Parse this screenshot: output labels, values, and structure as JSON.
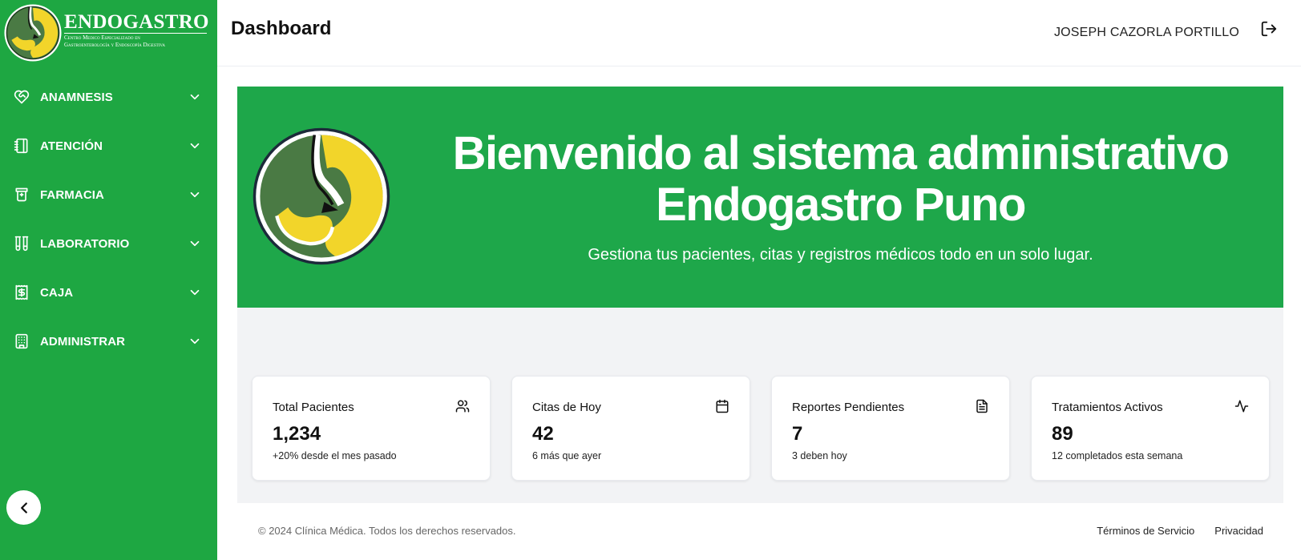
{
  "brand": {
    "name": "ENDOGASTRO",
    "subtitle_line1": "Centro Medico Especializado en",
    "subtitle_line2": "Gastroenterología y Endoscopía Digestiva"
  },
  "sidebar": {
    "items": [
      {
        "label": "ANAMNESIS",
        "icon": "heart-handshake-icon"
      },
      {
        "label": "ATENCIÓN",
        "icon": "notebook-icon"
      },
      {
        "label": "FARMACIA",
        "icon": "medicine-bottle-icon"
      },
      {
        "label": "LABORATORIO",
        "icon": "test-tubes-icon"
      },
      {
        "label": "CAJA",
        "icon": "receipt-dollar-icon"
      },
      {
        "label": "ADMINISTRAR",
        "icon": "building-icon"
      }
    ]
  },
  "header": {
    "title": "Dashboard",
    "user_name": "JOSEPH CAZORLA PORTILLO"
  },
  "hero": {
    "title_line1": "Bienvenido al sistema administrativo",
    "title_line2": "Endogastro Puno",
    "subtitle": "Gestiona tus pacientes, citas y registros médicos todo en un solo lugar."
  },
  "stats": [
    {
      "title": "Total Pacientes",
      "value": "1,234",
      "note": "+20% desde el mes pasado",
      "icon": "users-icon"
    },
    {
      "title": "Citas de Hoy",
      "value": "42",
      "note": "6 más que ayer",
      "icon": "calendar-icon"
    },
    {
      "title": "Reportes Pendientes",
      "value": "7",
      "note": "3 deben hoy",
      "icon": "document-icon"
    },
    {
      "title": "Tratamientos Activos",
      "value": "89",
      "note": "12 completados esta semana",
      "icon": "activity-icon"
    }
  ],
  "footer": {
    "copyright": "© 2024 Clínica Médica. Todos los derechos reservados.",
    "terms": "Términos de Servicio",
    "privacy": "Privacidad"
  },
  "colors": {
    "sidebar_green": "#1ea742",
    "hero_green": "#1ea74a",
    "logo_yellow": "#f2d52a",
    "logo_dark_green": "#4a7a44"
  }
}
